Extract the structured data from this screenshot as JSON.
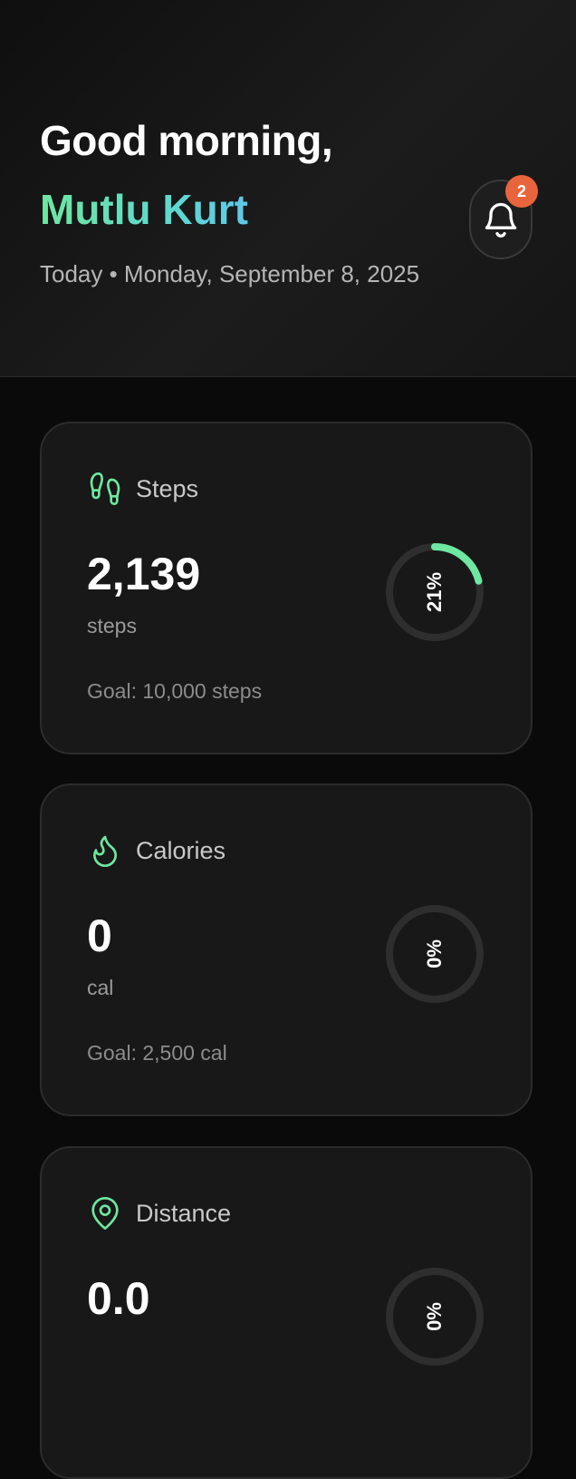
{
  "header": {
    "greeting": "Good morning,",
    "user_name": "Mutlu Kurt",
    "date_line": "Today • Monday, September 8, 2025",
    "notifications": {
      "icon": "bell-icon",
      "count": "2"
    }
  },
  "colors": {
    "accent_green": "#6ee7a0",
    "accent_cyan": "#5fc8e8",
    "badge": "#e8643c",
    "card_bg": "#181818",
    "ring_track": "#2e2e2e"
  },
  "cards": [
    {
      "icon": "footprints-icon",
      "title": "Steps",
      "value": "2,139",
      "unit": "steps",
      "goal": "Goal: 10,000 steps",
      "percent_label": "21%",
      "progress": 0.21
    },
    {
      "icon": "flame-icon",
      "title": "Calories",
      "value": "0",
      "unit": "cal",
      "goal": "Goal: 2,500 cal",
      "percent_label": "0%",
      "progress": 0
    },
    {
      "icon": "map-pin-icon",
      "title": "Distance",
      "value": "0.0",
      "unit": "",
      "goal": "",
      "percent_label": "0%",
      "progress": 0
    }
  ]
}
